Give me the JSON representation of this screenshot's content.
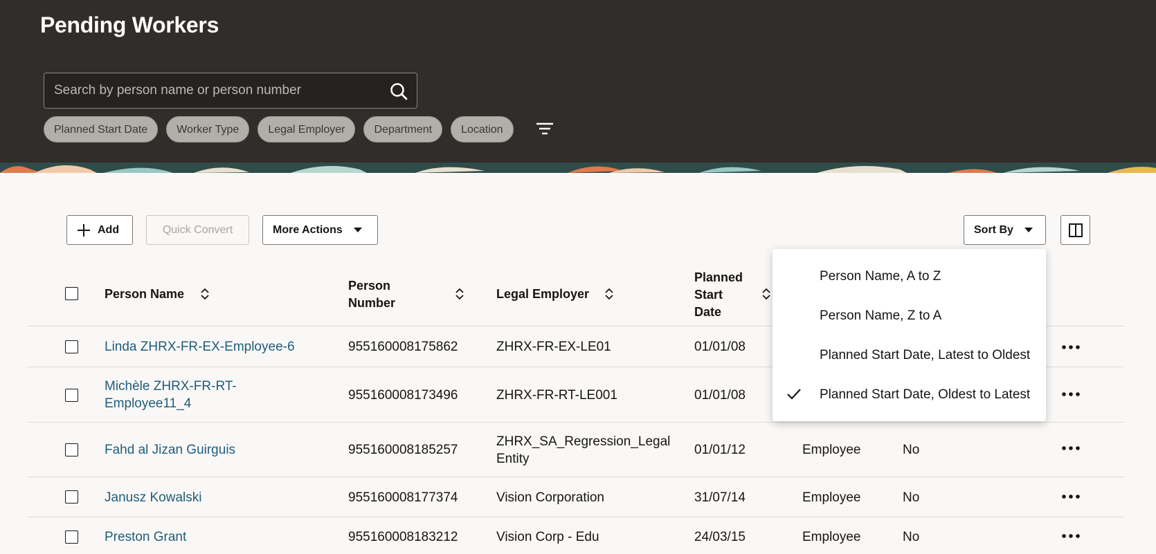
{
  "header": {
    "title": "Pending Workers",
    "search_placeholder": "Search by person name or person number",
    "filter_chips": [
      "Planned Start Date",
      "Worker Type",
      "Legal Employer",
      "Department",
      "Location"
    ]
  },
  "toolbar": {
    "add_label": "Add",
    "quick_convert_label": "Quick Convert",
    "more_actions_label": "More Actions",
    "sort_by_label": "Sort By"
  },
  "table": {
    "columns": {
      "person_name": "Person Name",
      "person_number_l1": "Person",
      "person_number_l2": "Number",
      "legal_employer": "Legal Employer",
      "planned_start_l1": "Planned",
      "planned_start_l2": "Start",
      "planned_start_l3": "Date"
    },
    "rows": [
      {
        "name_l1": "Linda ZHRX-FR-EX-Employee-6",
        "name_l2": "",
        "number": "955160008175862",
        "employer_l1": "ZHRX-FR-EX-LE01",
        "employer_l2": "",
        "date": "01/01/08",
        "worker_type": "",
        "flag": ""
      },
      {
        "name_l1": "Michèle ZHRX-FR-RT-",
        "name_l2": "Employee11_4",
        "number": "955160008173496",
        "employer_l1": "ZHRX-FR-RT-LE001",
        "employer_l2": "",
        "date": "01/01/08",
        "worker_type": "",
        "flag": ""
      },
      {
        "name_l1": "Fahd al Jizan Guirguis",
        "name_l2": "",
        "number": "955160008185257",
        "employer_l1": "ZHRX_SA_Regression_Legal",
        "employer_l2": "Entity",
        "date": "01/01/12",
        "worker_type": "Employee",
        "flag": "No"
      },
      {
        "name_l1": "Janusz Kowalski",
        "name_l2": "",
        "number": "955160008177374",
        "employer_l1": "Vision Corporation",
        "employer_l2": "",
        "date": "31/07/14",
        "worker_type": "Employee",
        "flag": "No"
      },
      {
        "name_l1": "Preston Grant",
        "name_l2": "",
        "number": "955160008183212",
        "employer_l1": "Vision Corp - Edu",
        "employer_l2": "",
        "date": "24/03/15",
        "worker_type": "Employee",
        "flag": "No"
      }
    ]
  },
  "sort_menu": {
    "options": [
      {
        "label": "Person Name, A to Z",
        "selected": false
      },
      {
        "label": "Person Name, Z to A",
        "selected": false
      },
      {
        "label": "Planned Start Date, Latest to Oldest",
        "selected": false
      },
      {
        "label": "Planned Start Date, Oldest to Latest",
        "selected": true
      }
    ]
  },
  "colors": {
    "header_bg": "#312d2a",
    "link": "#1f5c7a",
    "page_bg": "#f9f8f6"
  }
}
